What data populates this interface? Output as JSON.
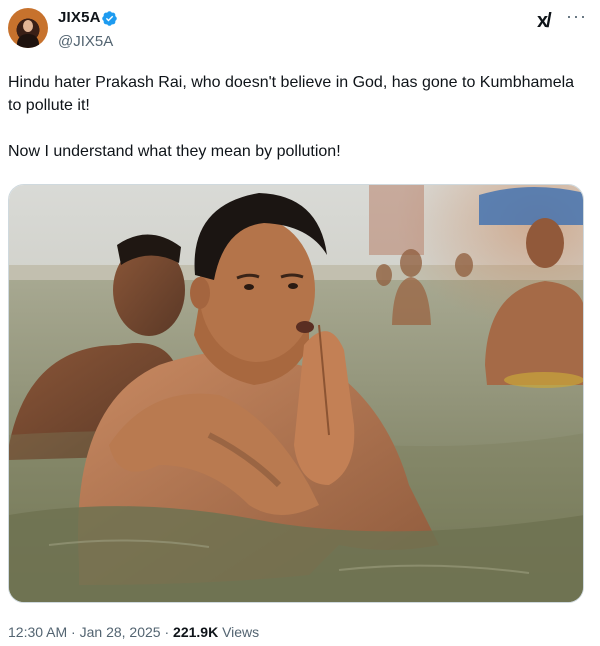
{
  "author": {
    "display_name": "JIX5A",
    "handle": "@JIX5A",
    "verified": true,
    "verified_color": "#1d9bf0"
  },
  "icons": {
    "grok": "grok-icon",
    "more": "more-icon"
  },
  "tweet": {
    "paragraph1": "Hindu hater Prakash Rai, who doesn't believe in God, has gone to Kumbhamela to pollute it!",
    "paragraph2": "Now I understand what they mean by pollution!"
  },
  "meta": {
    "time": "12:30 AM",
    "date": "Jan 28, 2025",
    "views_count": "221.9K",
    "views_label": "Views"
  }
}
